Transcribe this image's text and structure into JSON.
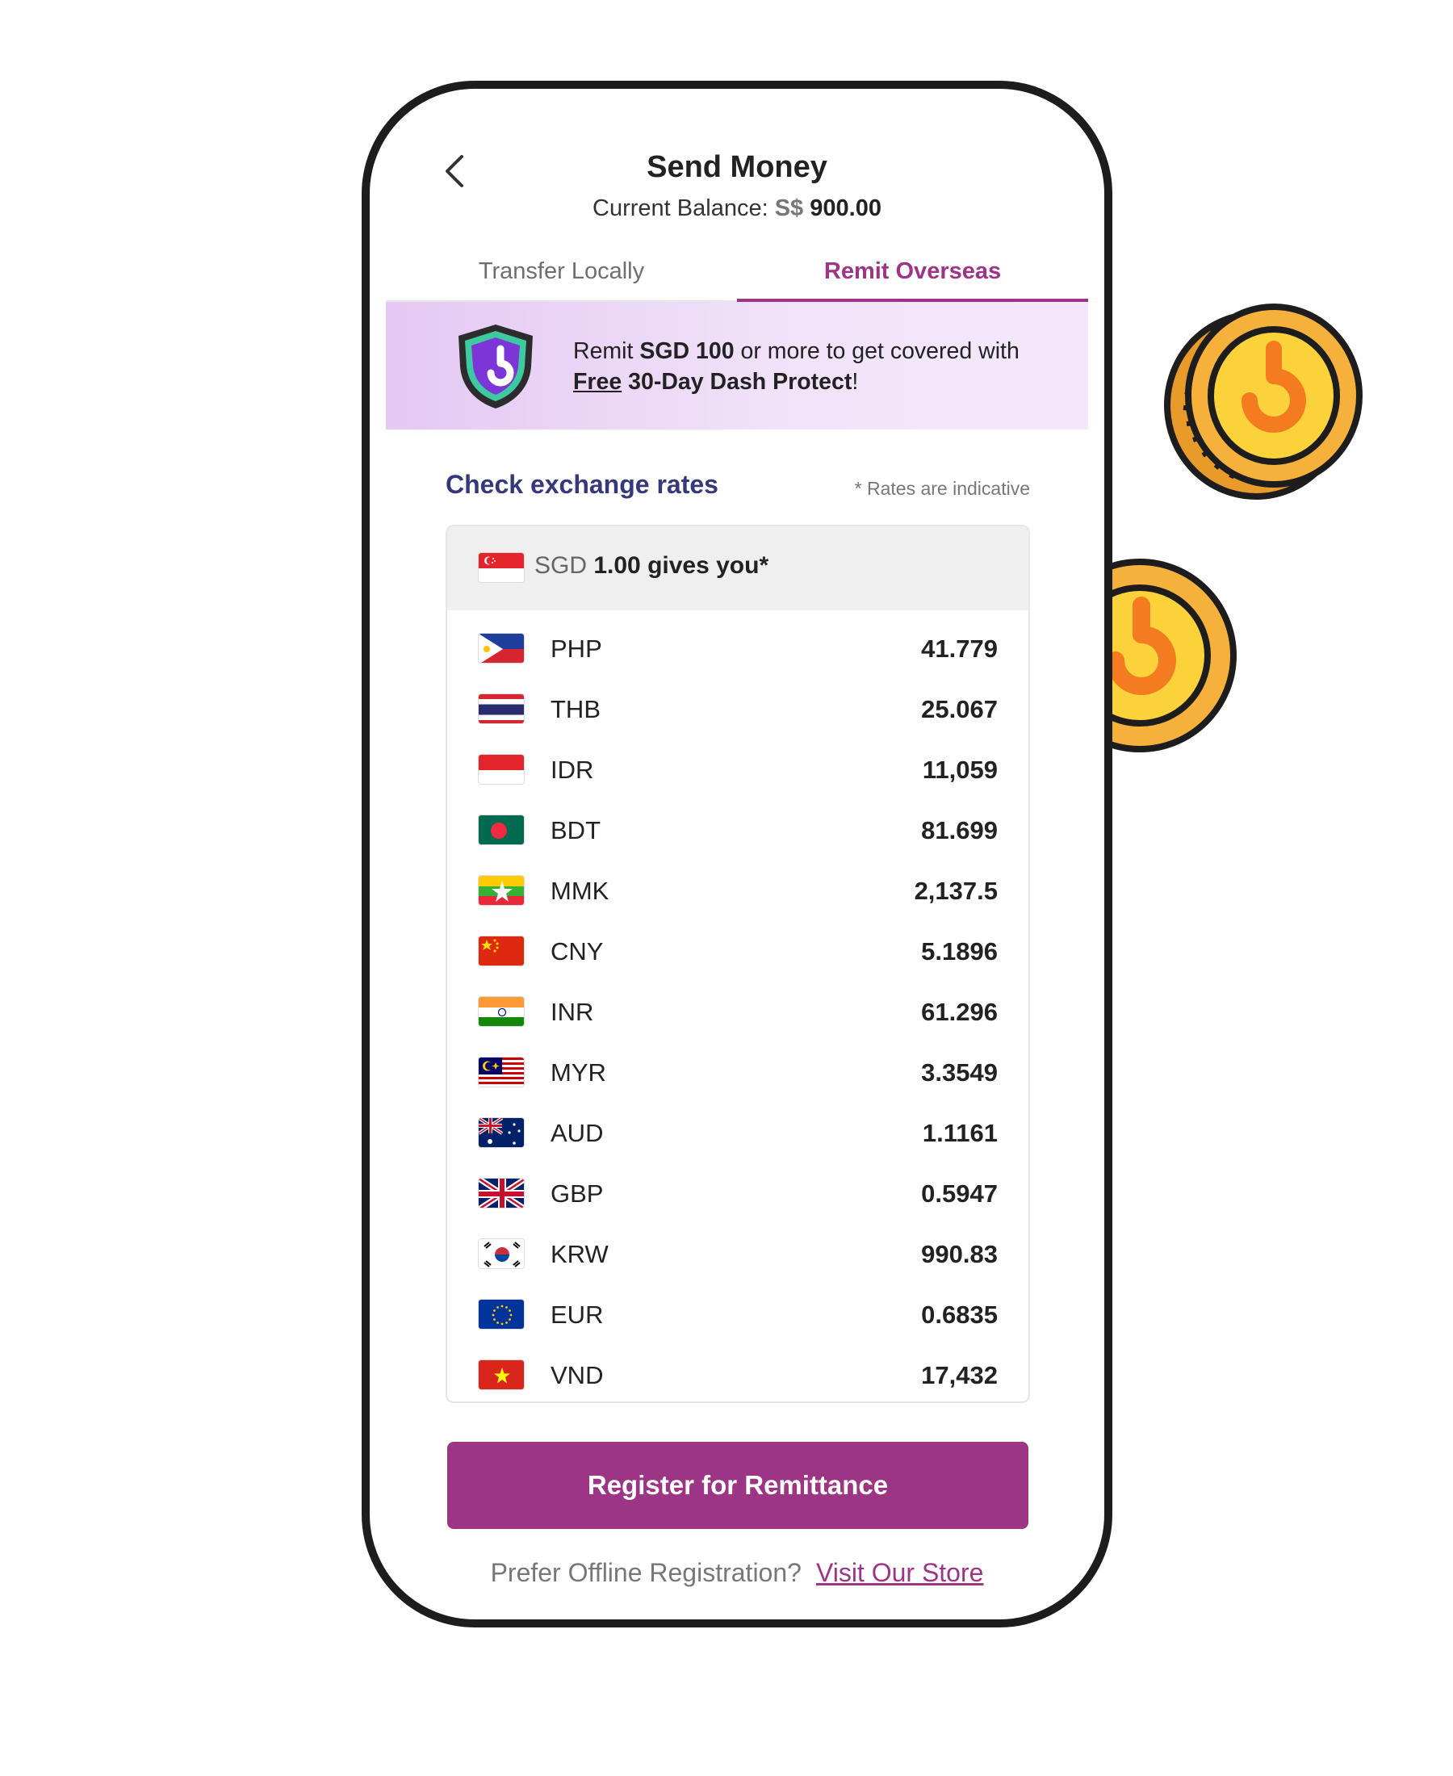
{
  "colors": {
    "accent": "#9b3584",
    "rates_title": "#35397a",
    "promo_bg": "#ead6f6",
    "coin_gold": "#f5b13b",
    "coin_orange": "#f47c20"
  },
  "header": {
    "back_icon": "chevron-left-icon",
    "title": "Send Money",
    "balance_label": "Current Balance:",
    "balance_currency": "S$",
    "balance_amount": "900.00"
  },
  "tabs": [
    {
      "label": "Transfer Locally",
      "active": false
    },
    {
      "label": "Remit Overseas",
      "active": true
    }
  ],
  "promo": {
    "icon": "shield-icon",
    "text_1": "Remit ",
    "text_amount": "SGD 100",
    "text_2": " or more to get covered with",
    "text_free": "Free",
    "text_product": " 30-Day Dash Protect",
    "text_end": "!"
  },
  "rates": {
    "title": "Check exchange rates",
    "note": "* Rates are indicative",
    "base_currency": "SGD",
    "base_text": " 1.00 gives you*",
    "rows": [
      {
        "code": "PHP",
        "value": "41.779"
      },
      {
        "code": "THB",
        "value": "25.067"
      },
      {
        "code": "IDR",
        "value": "11,059"
      },
      {
        "code": "BDT",
        "value": "81.699"
      },
      {
        "code": "MMK",
        "value": "2,137.5"
      },
      {
        "code": "CNY",
        "value": "5.1896"
      },
      {
        "code": "INR",
        "value": "61.296"
      },
      {
        "code": "MYR",
        "value": "3.3549"
      },
      {
        "code": "AUD",
        "value": "1.1161"
      },
      {
        "code": "GBP",
        "value": "0.5947"
      },
      {
        "code": "KRW",
        "value": "990.83"
      },
      {
        "code": "EUR",
        "value": "0.6835"
      },
      {
        "code": "VND",
        "value": "17,432"
      }
    ]
  },
  "cta": {
    "label": "Register for Remittance"
  },
  "offline": {
    "text": "Prefer Offline Registration?",
    "link": "Visit Our Store"
  }
}
